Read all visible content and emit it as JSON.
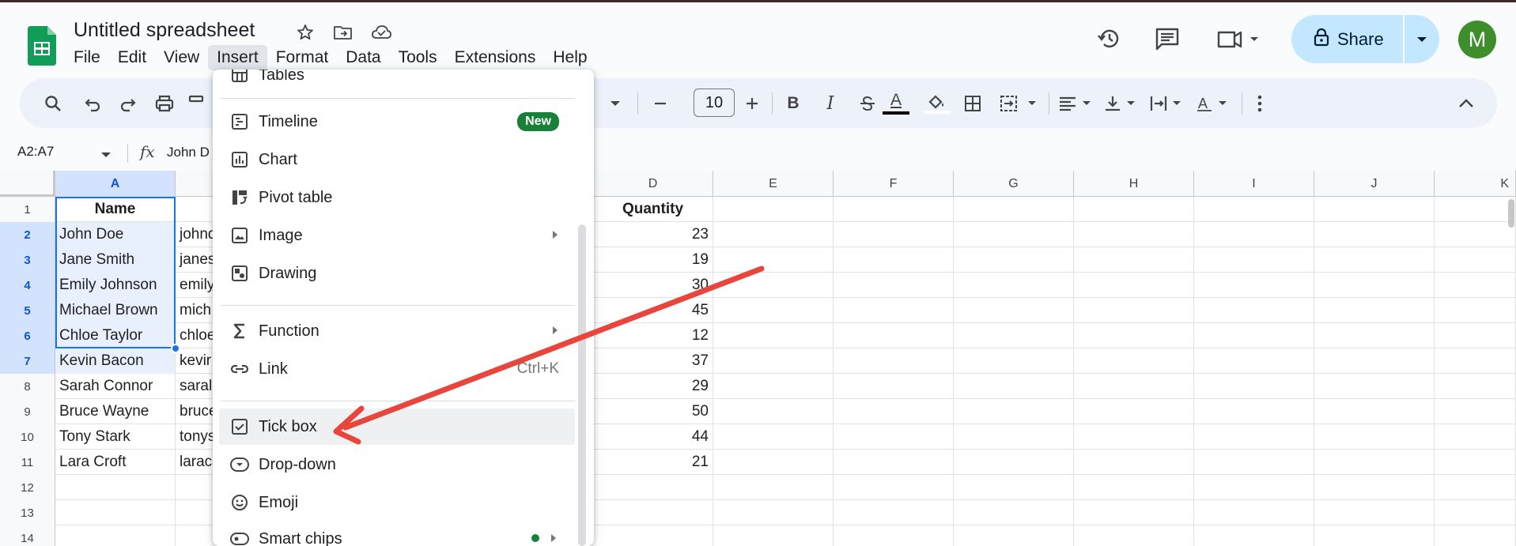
{
  "app": {
    "title": "Untitled spreadsheet",
    "menu": [
      "File",
      "Edit",
      "View",
      "Insert",
      "Format",
      "Data",
      "Tools",
      "Extensions",
      "Help"
    ],
    "active_menu": "Insert",
    "share_label": "Share",
    "avatar_letter": "M"
  },
  "toolbar": {
    "font_size": "10"
  },
  "formula_bar": {
    "name_box": "A2:A7",
    "value": "John D"
  },
  "grid": {
    "columns": [
      "A",
      "",
      "",
      "D",
      "E",
      "F",
      "G",
      "H",
      "I",
      "J",
      "K"
    ],
    "rows": [
      {
        "num": "1",
        "a": "Name",
        "b": "",
        "d": "Quantity"
      },
      {
        "num": "2",
        "a": "John Doe",
        "b": "johnd",
        "d": "23"
      },
      {
        "num": "3",
        "a": "Jane Smith",
        "b": "janes",
        "d": "19"
      },
      {
        "num": "4",
        "a": "Emily Johnson",
        "b": "emily",
        "d": "30"
      },
      {
        "num": "5",
        "a": "Michael Brown",
        "b": "mich",
        "d": "45"
      },
      {
        "num": "6",
        "a": "Chloe Taylor",
        "b": "chloe",
        "d": "12"
      },
      {
        "num": "7",
        "a": "Kevin Bacon",
        "b": "kevir",
        "d": "37"
      },
      {
        "num": "8",
        "a": "Sarah Connor",
        "b": "saral",
        "d": "29"
      },
      {
        "num": "9",
        "a": "Bruce Wayne",
        "b": "bruce",
        "d": "50"
      },
      {
        "num": "10",
        "a": "Tony Stark",
        "b": "tonys",
        "d": "44"
      },
      {
        "num": "11",
        "a": "Lara Croft",
        "b": "larac",
        "d": "21"
      },
      {
        "num": "12",
        "a": "",
        "b": "",
        "d": ""
      },
      {
        "num": "13",
        "a": "",
        "b": "",
        "d": ""
      },
      {
        "num": "14",
        "a": "",
        "b": "",
        "d": ""
      }
    ]
  },
  "insert_menu": {
    "top_partial": "Tables",
    "items": [
      {
        "label": "Timeline",
        "icon": "timeline-icon",
        "badge": "New"
      },
      {
        "label": "Chart",
        "icon": "chart-icon"
      },
      {
        "label": "Pivot table",
        "icon": "pivot-table-icon"
      },
      {
        "label": "Image",
        "icon": "image-icon",
        "submenu": true
      },
      {
        "label": "Drawing",
        "icon": "drawing-icon"
      },
      {
        "label": "Function",
        "icon": "sigma-icon",
        "submenu": true
      },
      {
        "label": "Link",
        "icon": "link-icon",
        "shortcut": "Ctrl+K"
      },
      {
        "label": "Tick box",
        "icon": "checkbox-icon",
        "highlighted": true
      },
      {
        "label": "Drop-down",
        "icon": "dropdown-chip-icon"
      },
      {
        "label": "Emoji",
        "icon": "emoji-icon"
      },
      {
        "label": "Smart chips",
        "icon": "smart-chips-icon",
        "submenu": true
      }
    ]
  },
  "annotation": {
    "color": "#e8453c",
    "points_to": "Tick box"
  }
}
